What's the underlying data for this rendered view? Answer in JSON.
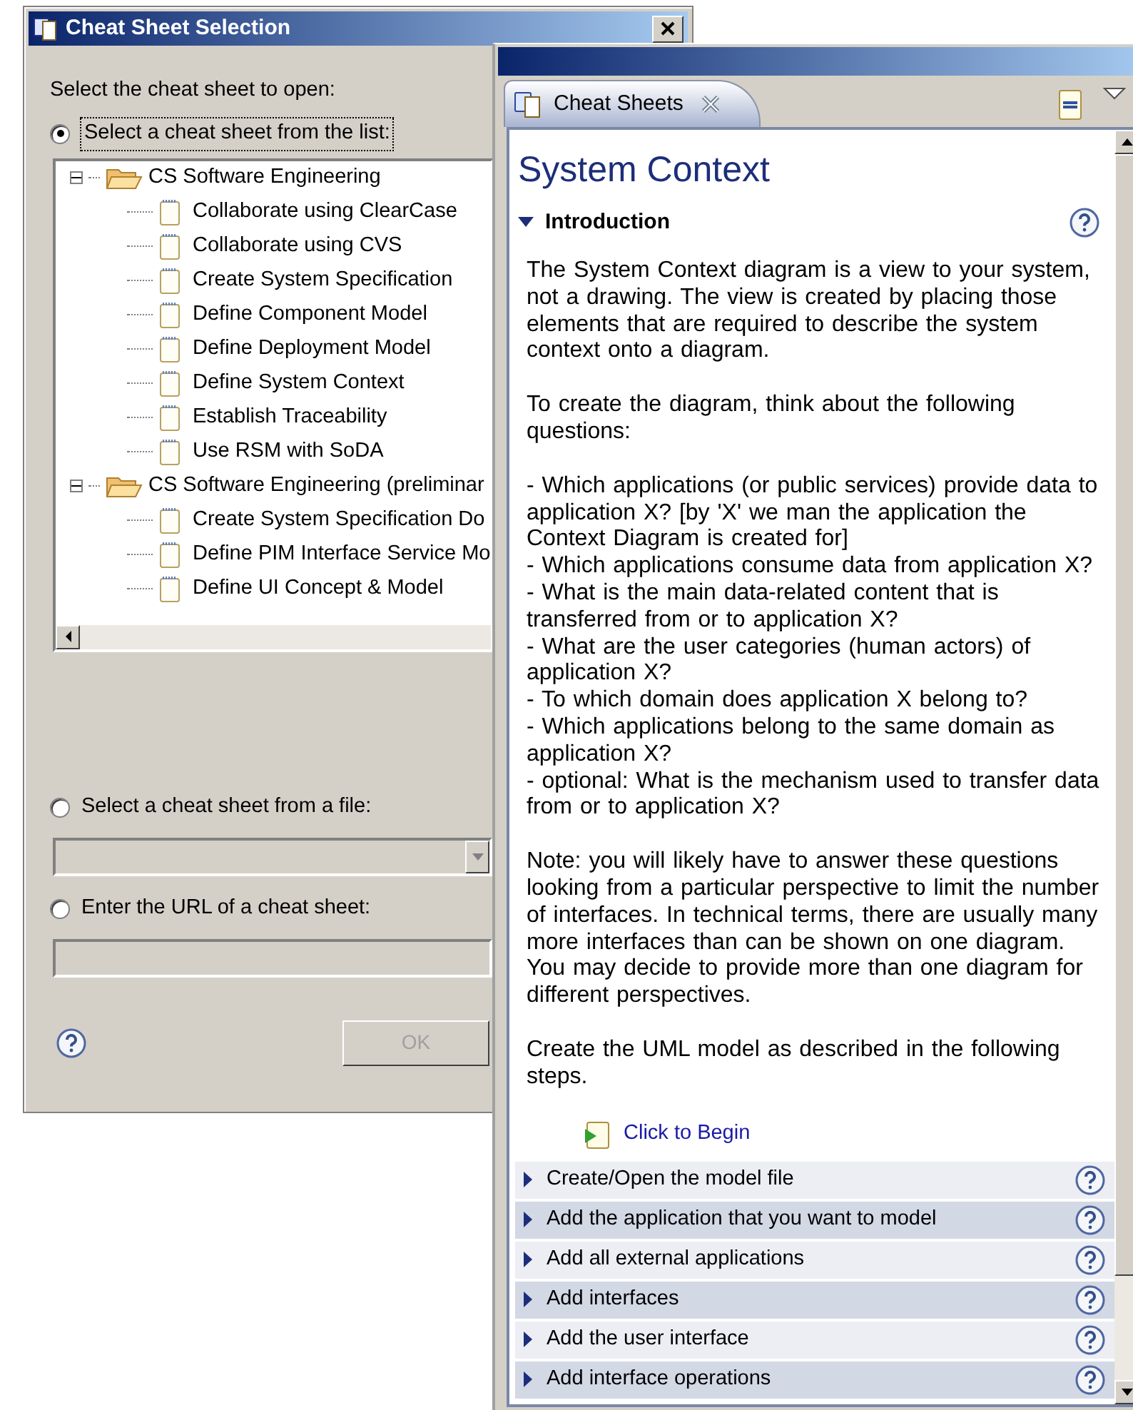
{
  "dialog": {
    "title": "Cheat Sheet Selection",
    "prompt": "Select the cheat sheet to open:",
    "options": [
      {
        "label": "Select a cheat sheet from the list:",
        "selected": true,
        "kind": "tree"
      },
      {
        "label": "Select a cheat sheet from a file:",
        "selected": false,
        "kind": "combo"
      },
      {
        "label": "Enter the URL of a cheat sheet:",
        "selected": false,
        "kind": "text"
      }
    ],
    "tree": [
      {
        "label": "CS Software Engineering",
        "expanded": true,
        "children": [
          {
            "label": "Collaborate using ClearCase"
          },
          {
            "label": "Collaborate using CVS"
          },
          {
            "label": "Create System Specification"
          },
          {
            "label": "Define Component Model"
          },
          {
            "label": "Define Deployment Model"
          },
          {
            "label": "Define System Context"
          },
          {
            "label": "Establish Traceability"
          },
          {
            "label": "Use RSM with SoDA"
          }
        ]
      },
      {
        "label": "CS Software Engineering (preliminar",
        "expanded": true,
        "children": [
          {
            "label": "Create System Specification Do"
          },
          {
            "label": "Define PIM Interface Service Mo"
          },
          {
            "label": "Define UI Concept & Model"
          }
        ]
      }
    ],
    "ok_button": {
      "label": "OK",
      "disabled": true
    }
  },
  "cheat_sheets": {
    "tab": {
      "label": "Cheat Sheets",
      "selected": true
    },
    "title": "System Context",
    "intro": {
      "heading": "Introduction",
      "expanded": true,
      "blocks": [
        {
          "kind": "text",
          "text": "The System Context diagram is a view to your system, not a drawing. The view is created by placing those elements that are required to describe the system context onto a diagram."
        },
        {
          "kind": "text",
          "text": "To create the diagram, think about the following questions:"
        },
        {
          "kind": "lines",
          "lines": [
            "- Which applications (or public services) provide data to application X? [by 'X' we man the application the Context Diagram is created for]",
            "- Which applications consume data from application X?",
            "- What is the main data-related content that is transferred from or to application X?",
            "- What are the user categories (human actors) of application X?",
            "- To which domain does application X belong to?",
            "- Which applications belong to the same domain as application X?",
            "- optional: What is the mechanism used to transfer data from or to application X?"
          ]
        },
        {
          "kind": "text",
          "text": "Note: you will likely have to answer these questions looking from a particular perspective to limit the number of interfaces. In technical terms, there are usually many more interfaces than can be shown on one diagram. You may decide to provide more than one diagram for different perspectives."
        },
        {
          "kind": "text",
          "text": "Create the UML model as described in the following steps."
        }
      ],
      "begin_link": "Click to Begin"
    },
    "steps": [
      {
        "label": "Create/Open the model file",
        "expanded": false
      },
      {
        "label": "Add the application that you want to model",
        "expanded": false
      },
      {
        "label": "Add all external applications",
        "expanded": false
      },
      {
        "label": "Add interfaces",
        "expanded": false
      },
      {
        "label": "Add the user interface",
        "expanded": false
      },
      {
        "label": "Add interface operations",
        "expanded": false
      }
    ]
  }
}
